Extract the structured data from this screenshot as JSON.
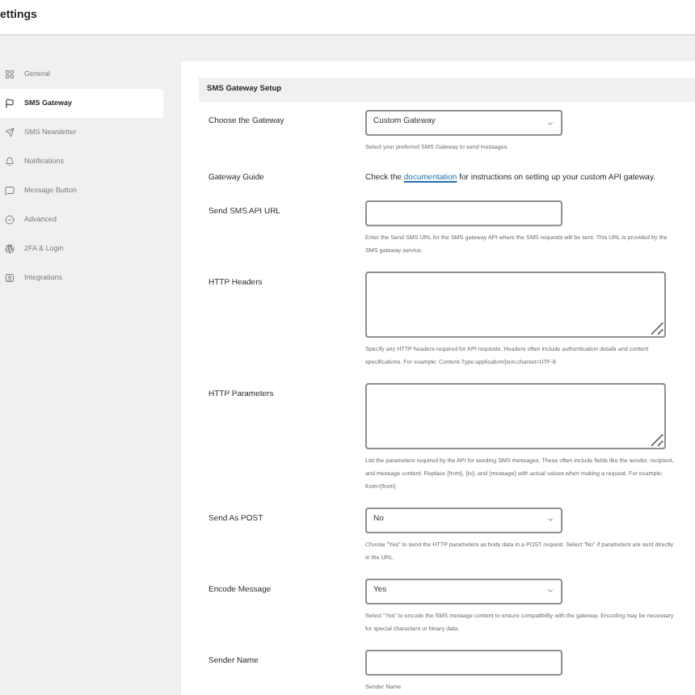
{
  "header": {
    "title": "ettings"
  },
  "sidebar": {
    "items": [
      {
        "label": "General",
        "selected": false
      },
      {
        "label": "SMS Gateway",
        "selected": true
      },
      {
        "label": "SMS Newsletter",
        "selected": false
      },
      {
        "label": "Notifications",
        "selected": false
      },
      {
        "label": "Message Button",
        "selected": false
      },
      {
        "label": "Advanced",
        "selected": false
      },
      {
        "label": "2FA & Login",
        "selected": false
      },
      {
        "label": "Integrations",
        "selected": false
      }
    ]
  },
  "section": {
    "title": "SMS Gateway Setup",
    "fields": [
      {
        "kind": "select",
        "label": "Choose the Gateway",
        "value": "Custom Gateway",
        "help": "Select your preferred SMS Gateway to send messages."
      },
      {
        "kind": "guide",
        "label": "Gateway Guide",
        "text_before": "Check the",
        "link": "documentation",
        "text_after": "for instructions on setting up your custom API gateway."
      },
      {
        "kind": "text",
        "label": "Send SMS API URL",
        "help": "Enter the Send SMS URL for the SMS gateway API where the SMS requests will be sent. This URL is provided by the SMS gateway service."
      },
      {
        "kind": "textarea",
        "label": "HTTP Headers",
        "help": "Specify any HTTP headers required for API requests. Headers often include authentication details and content specifications. For example: Content-Type:application/json;charset=UTF-8"
      },
      {
        "kind": "textarea",
        "label": "HTTP Parameters",
        "help": "List the parameters required by the API for sending SMS messages. These often include fields like the sender, recipient, and message content. Replace {from}, {to}, and {message} with actual values when making a request. For example: from={from}"
      },
      {
        "kind": "select",
        "label": "Send As POST",
        "value": "No",
        "help": "Choose \"Yes\" to send the HTTP parameters as body data in a POST request. Select \"No\" if parameters are sent directly in the URL."
      },
      {
        "kind": "select",
        "label": "Encode Message",
        "value": "Yes",
        "help": "Select \"Yes\" to encode the SMS message content to ensure compatibility with the gateway. Encoding may be necessary for special characters or binary data."
      },
      {
        "kind": "text",
        "label": "Sender Name",
        "help": "Sender Name"
      }
    ]
  }
}
